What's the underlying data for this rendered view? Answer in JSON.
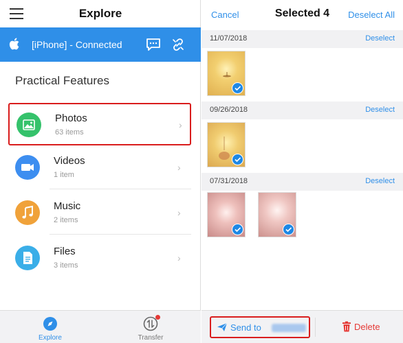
{
  "left": {
    "header": {
      "title": "Explore",
      "menu_icon": "hamburger-menu-icon"
    },
    "device": {
      "name": "[iPhone] - Connected",
      "bar_color": "#2f8fe8"
    },
    "section_title": "Practical Features",
    "features": [
      {
        "name": "Photos",
        "count": "63 items",
        "icon": "photo-icon",
        "color": "#35c26b"
      },
      {
        "name": "Videos",
        "count": "1 item",
        "icon": "video-camera-icon",
        "color": "#3d8ef0"
      },
      {
        "name": "Music",
        "count": "2 items",
        "icon": "music-note-icon",
        "color": "#f0a23a"
      },
      {
        "name": "Files",
        "count": "3 items",
        "icon": "file-icon",
        "color": "#3aaee8"
      }
    ],
    "tabs": [
      {
        "label": "Explore",
        "icon": "compass-icon",
        "active": true
      },
      {
        "label": "Transfer",
        "icon": "transfer-icon",
        "active": false
      }
    ]
  },
  "right": {
    "header": {
      "cancel": "Cancel",
      "title": "Selected 4",
      "deselect_all": "Deselect All"
    },
    "groups": [
      {
        "date": "11/07/2018",
        "deselect": "Deselect"
      },
      {
        "date": "09/26/2018",
        "deselect": "Deselect"
      },
      {
        "date": "07/31/2018",
        "deselect": "Deselect"
      }
    ],
    "bottom": {
      "send_label": "Send to",
      "delete_label": "Delete"
    }
  },
  "colors": {
    "accent": "#2f8fe8",
    "highlight": "#d91c1c",
    "delete": "#e53935"
  }
}
